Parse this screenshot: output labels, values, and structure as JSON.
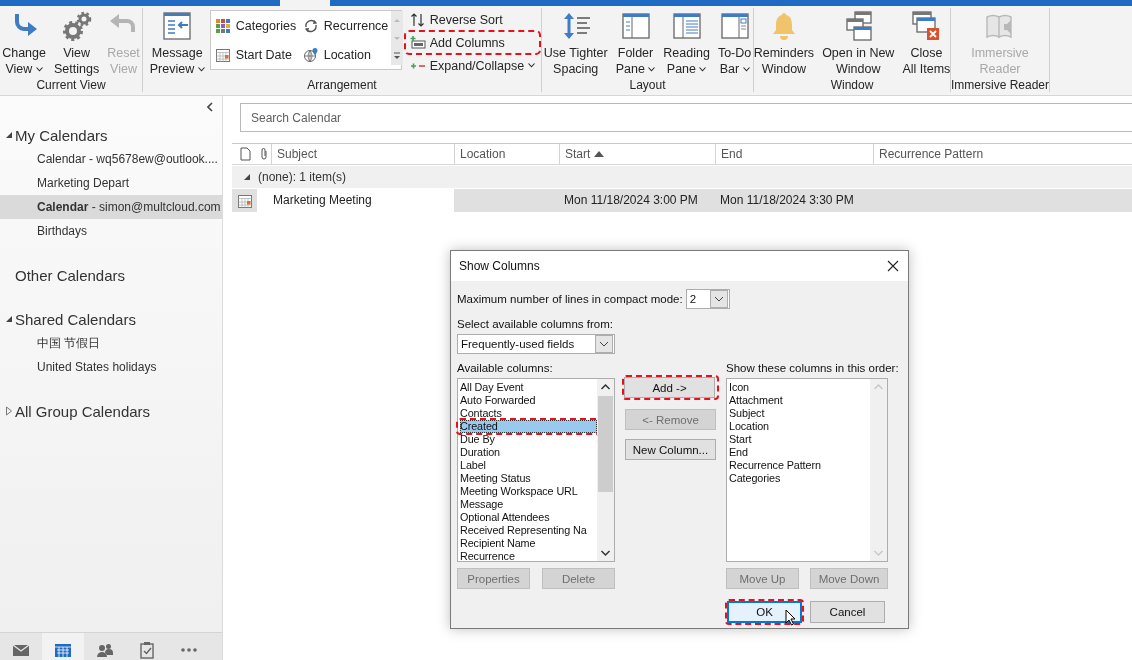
{
  "ribbon": {
    "groups": [
      {
        "label": "Current View",
        "items": [
          {
            "kind": "large",
            "lines": [
              "Change",
              "View"
            ],
            "dropdown": true,
            "disabled": false
          },
          {
            "kind": "large",
            "lines": [
              "View",
              "Settings"
            ],
            "dropdown": false,
            "disabled": false
          },
          {
            "kind": "large",
            "lines": [
              "Reset",
              "View"
            ],
            "dropdown": false,
            "disabled": true
          }
        ]
      },
      {
        "label": "Arrangement",
        "items": [
          {
            "kind": "large",
            "lines": [
              "Message",
              "Preview"
            ],
            "dropdown": true,
            "disabled": false
          },
          {
            "kind": "gallery",
            "options": [
              {
                "label": "Categories"
              },
              {
                "label": "Recurrence"
              },
              {
                "label": "Start Date"
              },
              {
                "label": "Location"
              }
            ]
          },
          {
            "kind": "small",
            "buttons": [
              {
                "label": "Reverse Sort",
                "dropdown": false,
                "highlighted": false
              },
              {
                "label": "Add Columns",
                "dropdown": false,
                "highlighted": true
              },
              {
                "label": "Expand/Collapse",
                "dropdown": true,
                "highlighted": false
              }
            ]
          }
        ]
      },
      {
        "label": "Layout",
        "items": [
          {
            "kind": "large",
            "lines": [
              "Use Tighter",
              "Spacing"
            ],
            "dropdown": false,
            "disabled": false
          },
          {
            "kind": "large",
            "lines": [
              "Folder",
              "Pane"
            ],
            "dropdown": true,
            "disabled": false
          },
          {
            "kind": "large",
            "lines": [
              "Reading",
              "Pane"
            ],
            "dropdown": true,
            "disabled": false
          },
          {
            "kind": "large",
            "lines": [
              "To-Do",
              "Bar"
            ],
            "dropdown": true,
            "disabled": false
          }
        ]
      },
      {
        "label": "Window",
        "items": [
          {
            "kind": "large",
            "lines": [
              "Reminders",
              "Window"
            ],
            "dropdown": false,
            "disabled": false
          },
          {
            "kind": "large",
            "lines": [
              "Open in New",
              "Window"
            ],
            "dropdown": false,
            "disabled": false
          },
          {
            "kind": "large",
            "lines": [
              "Close",
              "All Items"
            ],
            "dropdown": false,
            "disabled": false
          }
        ]
      },
      {
        "label": "Immersive Reader",
        "items": [
          {
            "kind": "large",
            "lines": [
              "Immersive",
              "Reader"
            ],
            "dropdown": false,
            "disabled": true
          }
        ]
      }
    ]
  },
  "folder_pane": {
    "sections": [
      {
        "label": "My Calendars",
        "expanded": true,
        "children": [
          {
            "label": "Calendar - wq5678ew@outlook....",
            "selected": false
          },
          {
            "label": "Marketing Depart",
            "selected": false
          },
          {
            "label": "**Calendar** - simon@multcloud.com",
            "selected": true
          },
          {
            "label": "Birthdays",
            "selected": false
          }
        ]
      },
      {
        "label": "Other Calendars"
      },
      {
        "label": "Shared Calendars",
        "expanded": true,
        "children": [
          {
            "label": "中国 节假日",
            "selected": false
          },
          {
            "label": "United States holidays",
            "selected": false
          }
        ]
      },
      {
        "label": "All Group Calendars",
        "expanded": false
      }
    ],
    "nav": [
      {
        "selected": false
      },
      {
        "selected": true
      },
      {
        "selected": false
      },
      {
        "selected": false
      },
      {
        "selected": false
      }
    ]
  },
  "main": {
    "search": {
      "placeholder": "Search Calendar"
    },
    "columns": [
      {
        "kind": "icon"
      },
      {
        "kind": "icon"
      },
      {
        "kind": "text",
        "label": "Subject"
      },
      {
        "kind": "text",
        "label": "Location"
      },
      {
        "kind": "text",
        "label": "Start",
        "sorted_ascending": true
      },
      {
        "kind": "text",
        "label": "End"
      },
      {
        "kind": "text",
        "label": "Recurrence Pattern"
      }
    ],
    "groups": [
      {
        "label": "(none): 1 item(s)",
        "expanded": true,
        "rows": [
          {
            "subject": "Marketing Meeting",
            "start": "Mon 11/18/2024 3:00 PM",
            "end": "Mon 11/18/2024 3:30 PM",
            "selected": true
          }
        ]
      }
    ]
  },
  "dialog": {
    "title": "Show Columns",
    "max_lines": {
      "label": "Maximum number of lines in compact mode:",
      "value": "2"
    },
    "source": {
      "label": "Select available columns from:",
      "value": "Frequently-used fields"
    },
    "available": {
      "label": "Available columns:",
      "items": [
        {
          "label": "All Day Event",
          "selected": false,
          "highlighted": false
        },
        {
          "label": "Auto Forwarded",
          "selected": false,
          "highlighted": false
        },
        {
          "label": "Contacts",
          "selected": false,
          "highlighted": false
        },
        {
          "label": "Created",
          "selected": true,
          "highlighted": true
        },
        {
          "label": "Due By",
          "selected": false,
          "highlighted": false
        },
        {
          "label": "Duration",
          "selected": false,
          "highlighted": false
        },
        {
          "label": "Label",
          "selected": false,
          "highlighted": false
        },
        {
          "label": "Meeting Status",
          "selected": false,
          "highlighted": false
        },
        {
          "label": "Meeting Workspace URL",
          "selected": false,
          "highlighted": false
        },
        {
          "label": "Message",
          "selected": false,
          "highlighted": false
        },
        {
          "label": "Optional Attendees",
          "selected": false,
          "highlighted": false
        },
        {
          "label": "Received Representing Na",
          "selected": false,
          "highlighted": false
        },
        {
          "label": "Recipient Name",
          "selected": false,
          "highlighted": false
        },
        {
          "label": "Recurrence",
          "selected": false,
          "highlighted": false
        }
      ]
    },
    "shown": {
      "label": "Show these columns in this order:",
      "items": [
        {
          "label": "Icon"
        },
        {
          "label": "Attachment"
        },
        {
          "label": "Subject"
        },
        {
          "label": "Location"
        },
        {
          "label": "Start"
        },
        {
          "label": "End"
        },
        {
          "label": "Recurrence Pattern"
        },
        {
          "label": "Categories"
        }
      ]
    },
    "middle_buttons": [
      {
        "label": "Add ->",
        "disabled": false,
        "highlighted": true
      },
      {
        "label": "<- Remove",
        "disabled": true,
        "highlighted": false
      },
      {
        "label": "New Column...",
        "disabled": false,
        "highlighted": false
      }
    ],
    "left_buttons": [
      {
        "label": "Properties",
        "disabled": true,
        "highlighted": false
      },
      {
        "label": "Delete",
        "disabled": true,
        "highlighted": false
      }
    ],
    "right_buttons": [
      {
        "label": "Move Up",
        "disabled": true,
        "highlighted": false
      },
      {
        "label": "Move Down",
        "disabled": true,
        "highlighted": false
      }
    ],
    "footer_buttons": [
      {
        "label": "OK",
        "disabled": false,
        "highlighted": true,
        "default": true
      },
      {
        "label": "Cancel",
        "disabled": false,
        "highlighted": false,
        "default": false
      }
    ]
  }
}
